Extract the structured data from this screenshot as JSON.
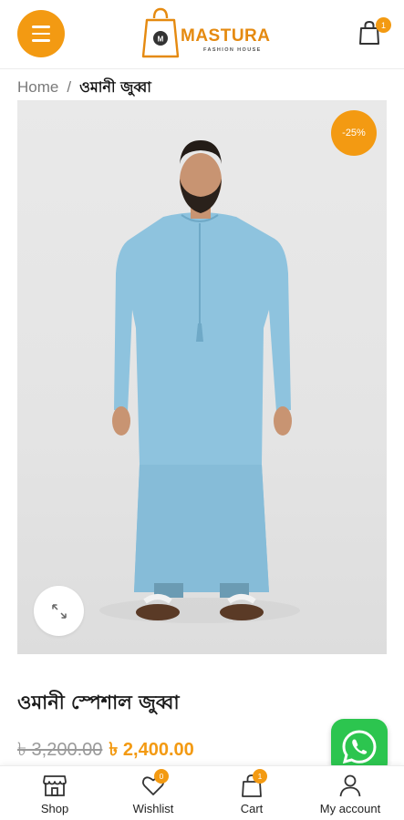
{
  "header": {
    "logo_text": "MASTURA",
    "logo_sub": "FASHION HOUSE",
    "cart_count": "1"
  },
  "breadcrumb": {
    "home": "Home",
    "separator": "/",
    "current": "ওমানী জুব্বা"
  },
  "product": {
    "sale_badge": "-25%",
    "title": "ওমানী স্পেশাল জুব্বা",
    "old_price": "৳ 3,200.00",
    "new_price": "৳ 2,400.00"
  },
  "bottom_nav": {
    "items": [
      {
        "label": "Shop",
        "icon": "shop-icon"
      },
      {
        "label": "Wishlist",
        "icon": "heart-icon",
        "badge": "0"
      },
      {
        "label": "Cart",
        "icon": "bag-icon",
        "badge": "1"
      },
      {
        "label": "My account",
        "icon": "user-icon"
      }
    ]
  },
  "colors": {
    "accent": "#f39a12",
    "whatsapp": "#2cc54f",
    "robe": "#8ec3de"
  }
}
